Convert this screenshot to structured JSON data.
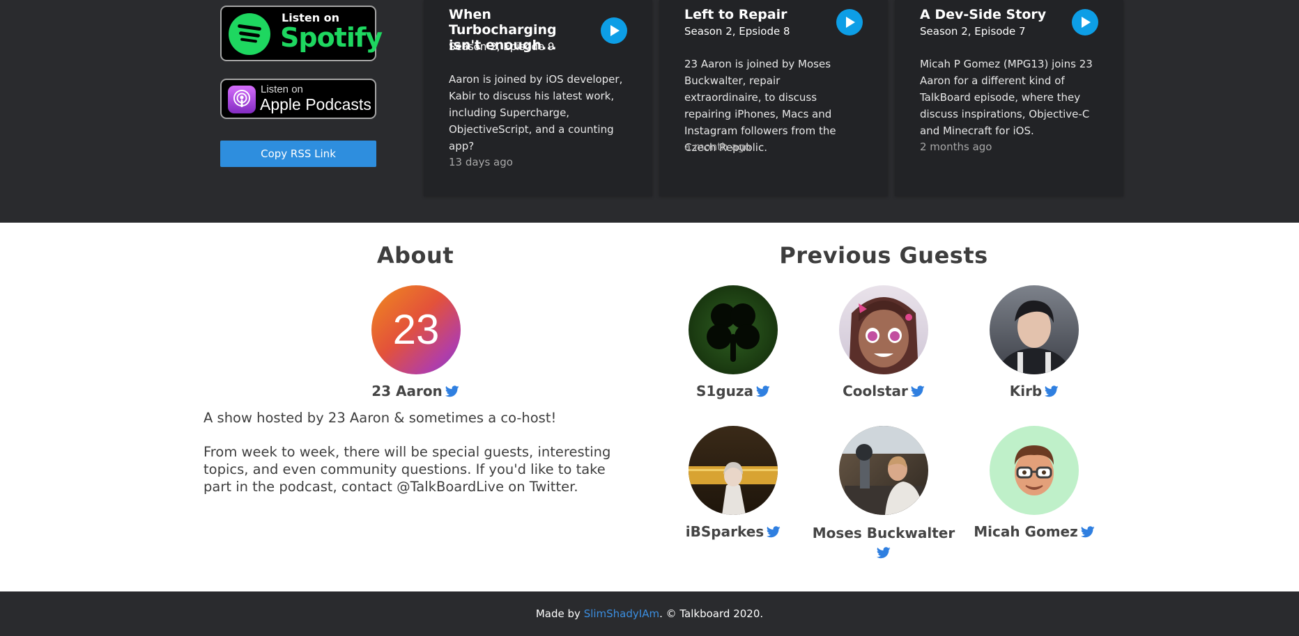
{
  "listen": {
    "spotify_small": "Listen on",
    "spotify_big": "Spotify",
    "apple_small": "Listen on",
    "apple_big": "Apple Podcasts",
    "rss_label": "Copy RSS Link"
  },
  "episodes": [
    {
      "title": "When Turbocharging isn't enough...",
      "season": "Season 2, Episode 9",
      "description": "Aaron is joined by iOS developer, Kabir to discuss his latest work, including Supercharge, ObjectiveScript, and a counting app?",
      "ago": "13 days ago"
    },
    {
      "title": "Left to Repair",
      "season": "Season 2, Epsiode 8",
      "description": "23 Aaron is joined by Moses Buckwalter, repair extraordinaire, to discuss repairing iPhones, Macs and Instagram followers from the Czech Republic.",
      "ago": "a month ago"
    },
    {
      "title": "A Dev-Side Story",
      "season": "Season 2, Episode 7",
      "description": "Micah P Gomez (MPG13) joins 23 Aaron for a different kind of TalkBoard episode, where they discuss inspirations, Objective-C and Minecraft for iOS.",
      "ago": "2 months ago"
    }
  ],
  "about": {
    "title": "About",
    "host_avatar_text": "23",
    "host_name": "23 Aaron",
    "paragraph1": "A show hosted by 23 Aaron & sometimes a co-host!",
    "paragraph2": "From week to week, there will be special guests, interesting topics, and even community questions. If you'd like to take part in the podcast, contact @TalkBoardLive on Twitter."
  },
  "guests": {
    "title": "Previous Guests",
    "items": [
      {
        "name": "S1guza"
      },
      {
        "name": "Coolstar"
      },
      {
        "name": "Kirb"
      },
      {
        "name": "iBSparkes"
      },
      {
        "name": "Moses Buckwalter"
      },
      {
        "name": "Micah Gomez"
      }
    ]
  },
  "footer": {
    "prefix": "Made by ",
    "author": "SlimShadyIAm",
    "suffix": ". © Talkboard 2020."
  },
  "colors": {
    "dark_band": "#2a2b2e",
    "card": "#222326",
    "accent_blue": "#2e8ede",
    "twitter_blue": "#2f7fe0",
    "spotify_green": "#1ed760"
  },
  "icons": {
    "play": "play-icon",
    "twitter": "twitter-icon",
    "spotify": "spotify-icon",
    "podcasts": "podcasts-icon"
  }
}
